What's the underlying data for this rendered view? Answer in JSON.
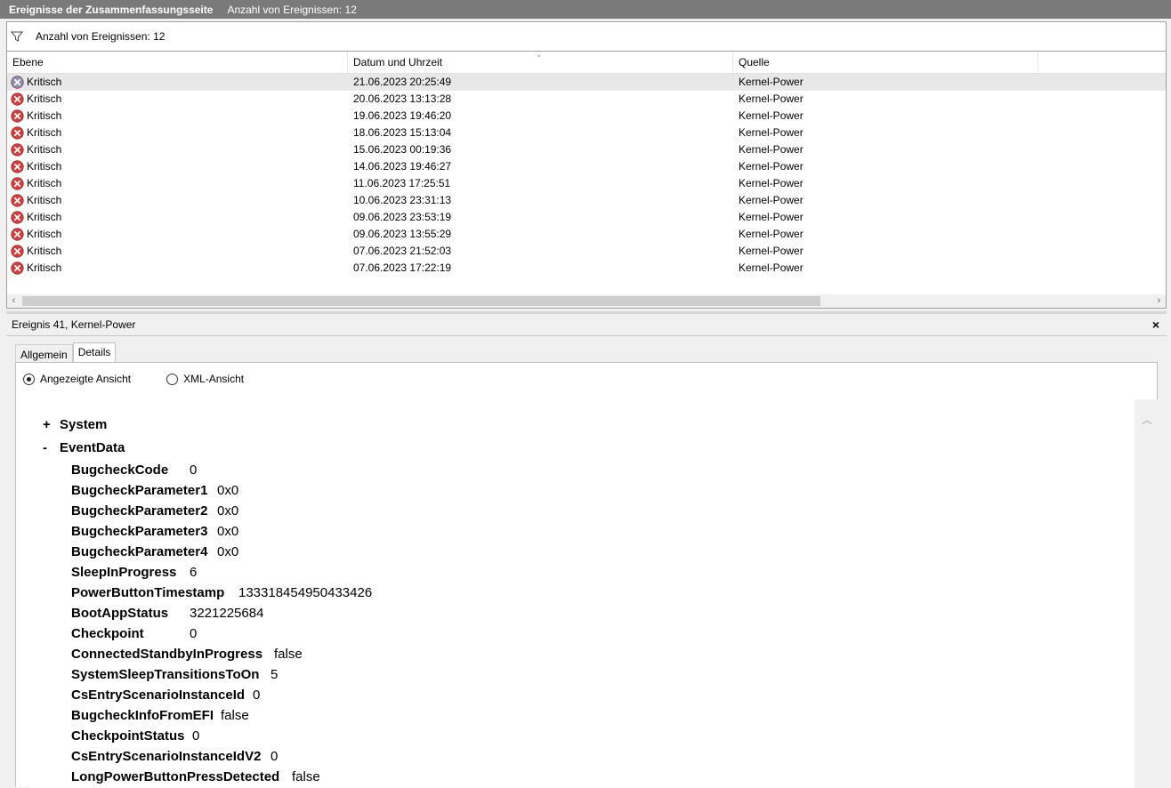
{
  "titlebar": {
    "title": "Ereignisse der Zusammenfassungsseite",
    "count_text": "Anzahl von Ereignissen: 12"
  },
  "filter": {
    "icon": "filter-icon",
    "text": "Anzahl von Ereignissen: 12"
  },
  "columns": {
    "level": "Ebene",
    "datetime": "Datum und Uhrzeit",
    "source": "Quelle"
  },
  "events": [
    {
      "level": "Kritisch",
      "datetime": "21.06.2023 20:25:49",
      "source": "Kernel-Power"
    },
    {
      "level": "Kritisch",
      "datetime": "20.06.2023 13:13:28",
      "source": "Kernel-Power"
    },
    {
      "level": "Kritisch",
      "datetime": "19.06.2023 19:46:20",
      "source": "Kernel-Power"
    },
    {
      "level": "Kritisch",
      "datetime": "18.06.2023 15:13:04",
      "source": "Kernel-Power"
    },
    {
      "level": "Kritisch",
      "datetime": "15.06.2023 00:19:36",
      "source": "Kernel-Power"
    },
    {
      "level": "Kritisch",
      "datetime": "14.06.2023 19:46:27",
      "source": "Kernel-Power"
    },
    {
      "level": "Kritisch",
      "datetime": "11.06.2023 17:25:51",
      "source": "Kernel-Power"
    },
    {
      "level": "Kritisch",
      "datetime": "10.06.2023 23:31:13",
      "source": "Kernel-Power"
    },
    {
      "level": "Kritisch",
      "datetime": "09.06.2023 23:53:19",
      "source": "Kernel-Power"
    },
    {
      "level": "Kritisch",
      "datetime": "09.06.2023 13:55:29",
      "source": "Kernel-Power"
    },
    {
      "level": "Kritisch",
      "datetime": "07.06.2023 21:52:03",
      "source": "Kernel-Power"
    },
    {
      "level": "Kritisch",
      "datetime": "07.06.2023 17:22:19",
      "source": "Kernel-Power"
    }
  ],
  "detail_panel": {
    "title": "Ereignis 41, Kernel-Power",
    "close": "×",
    "tabs": [
      "Allgemein",
      "Details"
    ],
    "active_tab": "Details",
    "views": {
      "displayed": "Angezeigte Ansicht",
      "xml": "XML-Ansicht",
      "selected": "displayed"
    },
    "tree": {
      "system": {
        "sign": "+",
        "label": "System"
      },
      "eventdata": {
        "sign": "-",
        "label": "EventData"
      },
      "fields": [
        {
          "key": "BugcheckCode",
          "value": "0"
        },
        {
          "key": "BugcheckParameter1",
          "value": "0x0"
        },
        {
          "key": "BugcheckParameter2",
          "value": "0x0"
        },
        {
          "key": "BugcheckParameter3",
          "value": "0x0"
        },
        {
          "key": "BugcheckParameter4",
          "value": "0x0"
        },
        {
          "key": "SleepInProgress",
          "value": "6"
        },
        {
          "key": "PowerButtonTimestamp",
          "value": "133318454950433426"
        },
        {
          "key": "BootAppStatus",
          "value": "3221225684"
        },
        {
          "key": "Checkpoint",
          "value": "0"
        },
        {
          "key": "ConnectedStandbyInProgress",
          "value": "false"
        },
        {
          "key": "SystemSleepTransitionsToOn",
          "value": "5"
        },
        {
          "key": "CsEntryScenarioInstanceId",
          "value": "0"
        },
        {
          "key": "BugcheckInfoFromEFI",
          "value": "false"
        },
        {
          "key": "CheckpointStatus",
          "value": "0"
        },
        {
          "key": "CsEntryScenarioInstanceIdV2",
          "value": "0"
        },
        {
          "key": "LongPowerButtonPressDetected",
          "value": "false"
        }
      ]
    }
  },
  "colors": {
    "titlebar_bg": "#7a7a7a",
    "critical_icon": "#d93a3a",
    "selected_row": "#e8e8e8"
  }
}
